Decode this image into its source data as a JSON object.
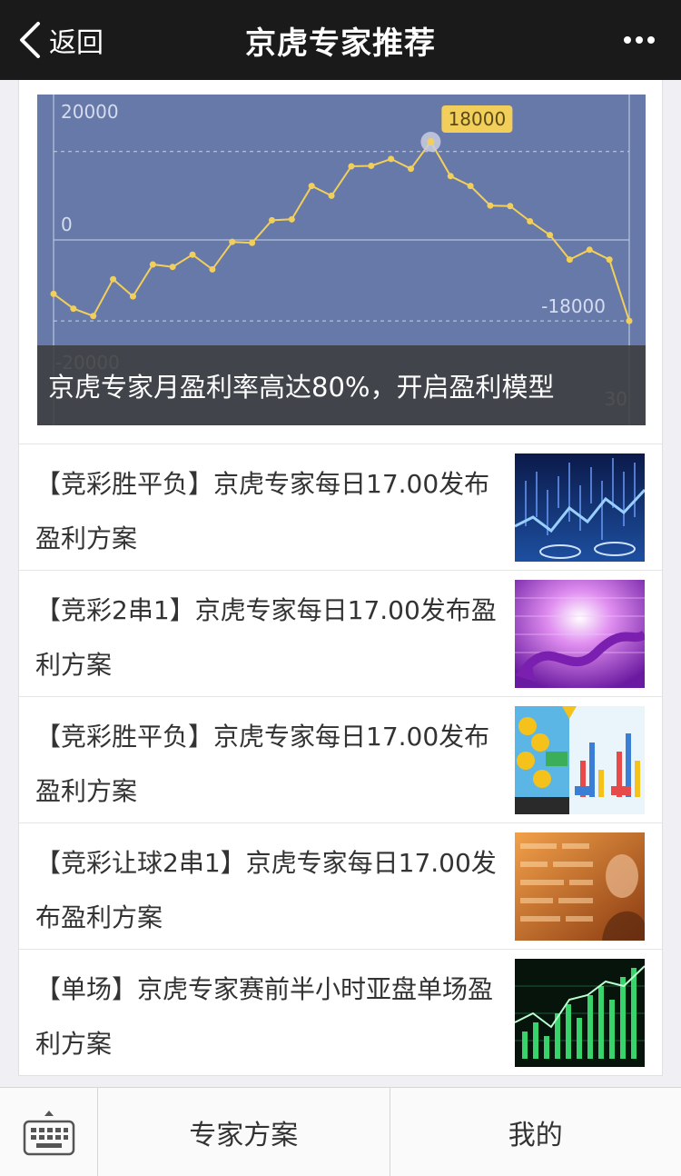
{
  "navbar": {
    "back_label": "返回",
    "title": "京虎专家推荐",
    "back_icon": "chevron-left-icon",
    "more_icon": "more-dots-icon"
  },
  "banner": {
    "caption": "京虎专家月盈利率高达80%，开启盈利模型",
    "highlight_label": "18000",
    "chart_data": {
      "type": "line",
      "title": "",
      "xlabel": "",
      "ylabel": "",
      "ytick_labels": [
        "20000",
        "0",
        "-18000",
        "-20000"
      ],
      "xtick_labels_visible": [
        "30"
      ],
      "ylim": [
        -20000,
        20000
      ],
      "grid": true,
      "series": [
        {
          "values": [
            -11000,
            -14000,
            -15500,
            -8000,
            -11500,
            -5000,
            -5500,
            -3000,
            -6000,
            -400,
            -600,
            4000,
            4200,
            11000,
            9000,
            15000,
            15100,
            16500,
            14500,
            20000,
            13000,
            11000,
            7000,
            6900,
            3800,
            1000,
            -4000,
            -2000,
            -4000,
            -16500
          ],
          "color": "#f2cf5b"
        }
      ]
    }
  },
  "articles": [
    {
      "title": "【竞彩胜平负】京虎专家每日17.00发布盈利方案",
      "thumb": "stock-chart-blue-thumb"
    },
    {
      "title": "【竞彩2串1】京虎专家每日17.00发布盈利方案",
      "thumb": "purple-arrow-chart-thumb"
    },
    {
      "title": "【竞彩胜平负】京虎专家每日17.00发布盈利方案",
      "thumb": "infographic-coins-thumb"
    },
    {
      "title": "【竞彩让球2串1】京虎专家每日17.00发布盈利方案",
      "thumb": "orange-ticker-board-thumb"
    },
    {
      "title": "【单场】京虎专家赛前半小时亚盘单场盈利方案",
      "thumb": "green-candlestick-thumb"
    }
  ],
  "tabbar": {
    "keyboard_icon": "keyboard-icon",
    "tabs": [
      {
        "label": "专家方案"
      },
      {
        "label": "我的"
      }
    ]
  },
  "colors": {
    "navbar_bg": "#1a1a1a",
    "banner_bg": "#6779a8",
    "line_color": "#f2cf5b"
  }
}
